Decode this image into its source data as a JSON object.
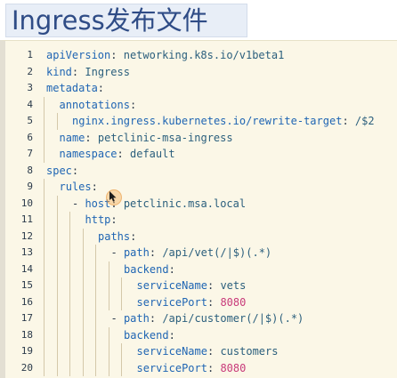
{
  "title": "Ingress发布文件",
  "code": {
    "lines": [
      {
        "n": "1",
        "indent": 0,
        "key": "apiVersion",
        "value": "networking.k8s.io/v1beta1",
        "value_type": "str"
      },
      {
        "n": "2",
        "indent": 0,
        "key": "kind",
        "value": "Ingress",
        "value_type": "str"
      },
      {
        "n": "3",
        "indent": 0,
        "key": "metadata",
        "value": "",
        "value_type": "str"
      },
      {
        "n": "4",
        "indent": 1,
        "key": "annotations",
        "value": "",
        "value_type": "str"
      },
      {
        "n": "5",
        "indent": 2,
        "key": "nginx.ingress.kubernetes.io/rewrite-target",
        "value": "/$2",
        "value_type": "str"
      },
      {
        "n": "6",
        "indent": 1,
        "key": "name",
        "value": "petclinic-msa-ingress",
        "value_type": "str"
      },
      {
        "n": "7",
        "indent": 1,
        "key": "namespace",
        "value": "default",
        "value_type": "str"
      },
      {
        "n": "8",
        "indent": 0,
        "key": "spec",
        "value": "",
        "value_type": "str"
      },
      {
        "n": "9",
        "indent": 1,
        "key": "rules",
        "value": "",
        "value_type": "str"
      },
      {
        "n": "10",
        "indent": 2,
        "dash": true,
        "key": "host",
        "value": "petclinic.msa.local",
        "value_type": "str"
      },
      {
        "n": "11",
        "indent": 3,
        "key": "http",
        "value": "",
        "value_type": "str"
      },
      {
        "n": "12",
        "indent": 4,
        "key": "paths",
        "value": "",
        "value_type": "str"
      },
      {
        "n": "13",
        "indent": 5,
        "dash": true,
        "key": "path",
        "value": "/api/vet(/|$)(.*)",
        "value_type": "str"
      },
      {
        "n": "14",
        "indent": 6,
        "key": "backend",
        "value": "",
        "value_type": "str"
      },
      {
        "n": "15",
        "indent": 7,
        "key": "serviceName",
        "value": "vets",
        "value_type": "str"
      },
      {
        "n": "16",
        "indent": 7,
        "key": "servicePort",
        "value": "8080",
        "value_type": "num"
      },
      {
        "n": "17",
        "indent": 5,
        "dash": true,
        "key": "path",
        "value": "/api/customer(/|$)(.*)",
        "value_type": "str"
      },
      {
        "n": "18",
        "indent": 6,
        "key": "backend",
        "value": "",
        "value_type": "str"
      },
      {
        "n": "19",
        "indent": 7,
        "key": "serviceName",
        "value": "customers",
        "value_type": "str"
      },
      {
        "n": "20",
        "indent": 7,
        "key": "servicePort",
        "value": "8080",
        "value_type": "num"
      }
    ]
  },
  "colors": {
    "title_bg": "#e8eef7",
    "title_text": "#2f4c86",
    "code_bg": "#fbf7e7",
    "key": "#1f65b3",
    "string": "#2b5f7d",
    "number": "#c83a7a"
  }
}
